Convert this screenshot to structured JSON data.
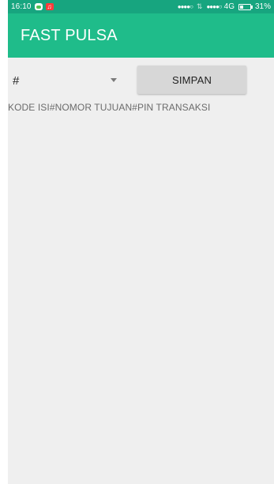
{
  "status_bar": {
    "time": "16:10",
    "signal_1": "●●●●○",
    "data_arrows": "⇅",
    "signal_2": "●●●●○",
    "network": "4G",
    "battery_percent": "31%",
    "battery_level_fraction": 0.31,
    "icons": [
      "chat-notification-icon",
      "music-notification-icon",
      "battery-icon"
    ]
  },
  "app_bar": {
    "title": "FAST PULSA"
  },
  "form": {
    "separator_selected": "#",
    "save_label": "SIMPAN",
    "format_hint": "KODE ISI#NOMOR TUJUAN#PIN TRANSAKSI"
  },
  "colors": {
    "status_bar": "#17a57f",
    "app_bar": "#1fbc8a",
    "background": "#efefef",
    "button": "#d7d7d7"
  }
}
